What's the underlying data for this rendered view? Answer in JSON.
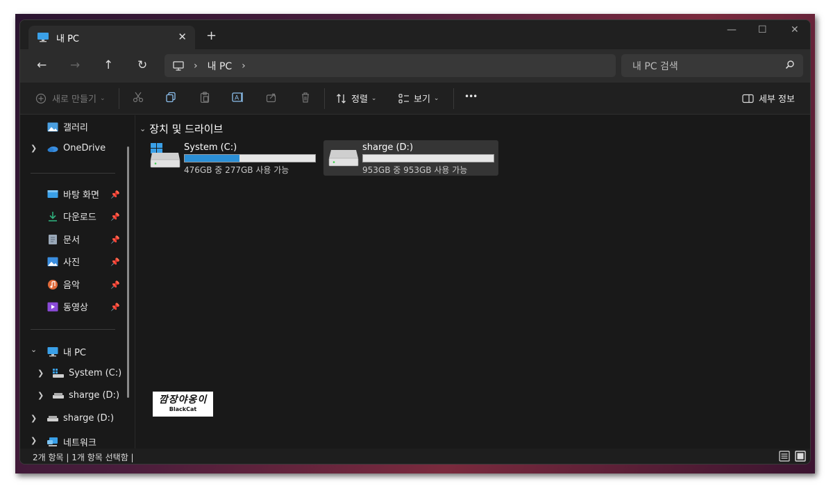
{
  "tab": {
    "title": "내 PC",
    "close": "✕",
    "new": "+"
  },
  "window_controls": {
    "minimize": "—",
    "maximize": "☐",
    "close": "✕"
  },
  "nav": {
    "back": "←",
    "forward": "→",
    "up": "↑",
    "refresh": "↻"
  },
  "address": {
    "segments": [
      "내 PC"
    ],
    "separator": "›"
  },
  "search": {
    "placeholder": "내 PC 검색"
  },
  "toolbar": {
    "new_label": "새로 만들기",
    "sort_label": "정렬",
    "view_label": "보기",
    "more_label": "•••",
    "details_label": "세부 정보"
  },
  "sidebar": {
    "gallery": "갤러리",
    "onedrive": "OneDrive",
    "pinned": [
      {
        "label": "바탕 화면",
        "icon": "desktop-icon"
      },
      {
        "label": "다운로드",
        "icon": "download-icon"
      },
      {
        "label": "문서",
        "icon": "document-icon"
      },
      {
        "label": "사진",
        "icon": "pictures-icon"
      },
      {
        "label": "음악",
        "icon": "music-icon"
      },
      {
        "label": "동영상",
        "icon": "videos-icon"
      }
    ],
    "this_pc": "내 PC",
    "system_c": "System (C:)",
    "sharge_d": "sharge (D:)",
    "sharge_d_root": "sharge (D:)",
    "network": "네트워크"
  },
  "content": {
    "section_title": "장치 및 드라이브",
    "drives": [
      {
        "name": "System (C:)",
        "info": "476GB 중 277GB 사용 가능",
        "used_fraction": 0.42,
        "selected": false
      },
      {
        "name": "sharge (D:)",
        "info": "953GB 중 953GB 사용 가능",
        "used_fraction": 0.0,
        "selected": true
      }
    ]
  },
  "watermark": {
    "line1": "깜장야옹이",
    "line2": "BlackCat"
  },
  "status": {
    "text": "2개 항목  |  1개 항목 선택함  |"
  },
  "colors": {
    "accent": "#2b8fd6",
    "window_bg": "#191919",
    "chrome_bg": "#202020"
  }
}
